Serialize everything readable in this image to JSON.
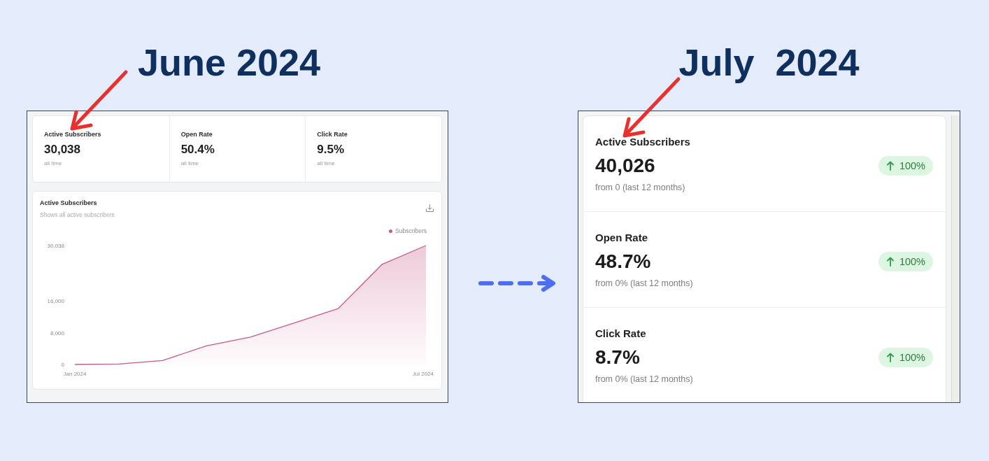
{
  "panels": [
    {
      "kind": "grid",
      "title": "June 2024",
      "stats": [
        {
          "label": "Active Subscribers",
          "value": "30,038",
          "note": "all time"
        },
        {
          "label": "Open Rate",
          "value": "50.4%",
          "note": "all time"
        },
        {
          "label": "Click Rate",
          "value": "9.5%",
          "note": "all time"
        }
      ],
      "chart_card": {
        "title": "Active Subscribers",
        "subtitle": "Shows all active subscribers",
        "chart_data": {
          "type": "area",
          "categories": [
            "Jan 2024",
            null,
            null,
            null,
            null,
            null,
            null,
            null,
            "Jul 2024"
          ],
          "series": [
            {
              "name": "Subscribers",
              "color": "#c9588a",
              "values": [
                0,
                100,
                1000,
                4700,
                6900,
                10500,
                14100,
                25300,
                30038
              ]
            }
          ],
          "ylim": [
            0,
            30038
          ],
          "yticks": [
            {
              "value": 0,
              "label": "0"
            },
            {
              "value": 8000,
              "label": "8,000"
            },
            {
              "value": 16000,
              "label": "16,000"
            },
            {
              "value": 30038,
              "label": "30,038"
            }
          ]
        }
      }
    },
    {
      "kind": "list",
      "title": "July  2024",
      "stats": [
        {
          "label": "Active Subscribers",
          "value": "40,026",
          "note": "from 0 (last 12 months)",
          "change": "100%"
        },
        {
          "label": "Open Rate",
          "value": "48.7%",
          "note": "from 0% (last 12 months)",
          "change": "100%"
        },
        {
          "label": "Click Rate",
          "value": "8.7%",
          "note": "from 0% (last 12 months)",
          "change": "100%"
        }
      ]
    }
  ]
}
